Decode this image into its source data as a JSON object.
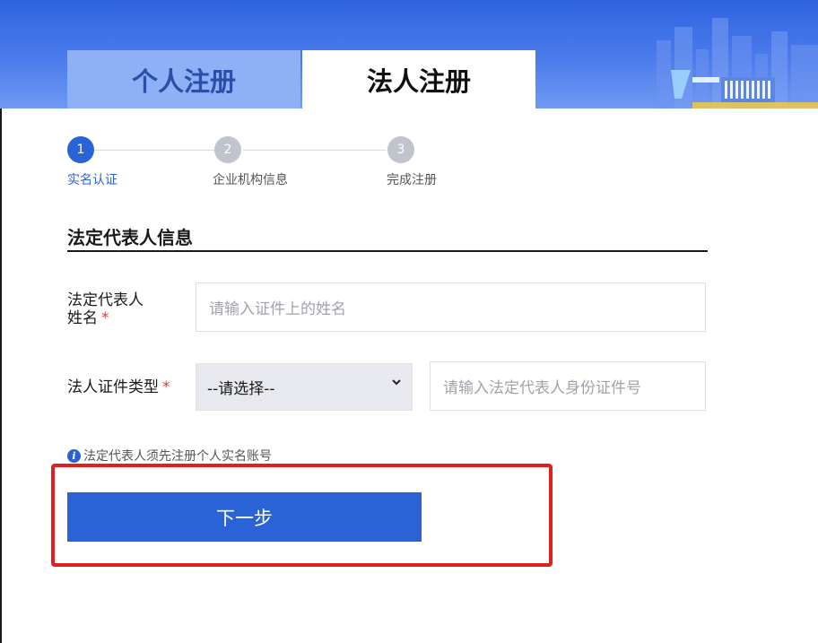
{
  "tabs": [
    {
      "label": "个人注册",
      "active": false
    },
    {
      "label": "法人注册",
      "active": true
    }
  ],
  "steps": [
    {
      "number": "1",
      "label": "实名认证",
      "active": true
    },
    {
      "number": "2",
      "label": "企业机构信息",
      "active": false
    },
    {
      "number": "3",
      "label": "完成注册",
      "active": false
    }
  ],
  "section": {
    "title": "法定代表人信息"
  },
  "form": {
    "name_label_line1": "法定代表人",
    "name_label_line2": "姓名",
    "required_mark": "*",
    "name_placeholder": "请输入证件上的姓名",
    "id_type_label": "法人证件类型",
    "id_type_selected": "--请选择--",
    "id_number_placeholder": "请输入法定代表人身份证件号"
  },
  "hint": {
    "icon": "info-icon",
    "text": "法定代表人须先注册个人实名账号"
  },
  "actions": {
    "next_label": "下一步"
  },
  "colors": {
    "primary": "#2a63d6",
    "required": "#e0382d",
    "highlight": "#e02020",
    "inactive_step": "#c0c4cc"
  }
}
